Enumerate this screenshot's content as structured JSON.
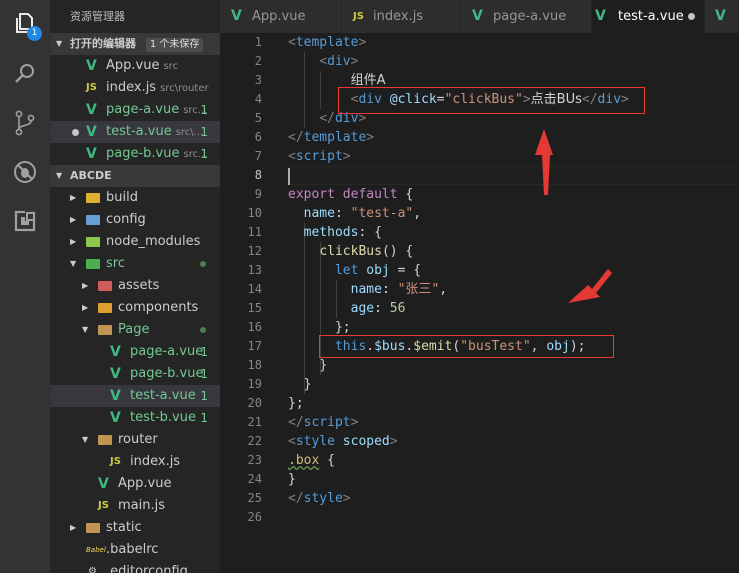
{
  "activity_bar": {
    "badge": "1",
    "icons": [
      "files-icon",
      "search-icon",
      "source-control-icon",
      "debug-icon",
      "extensions-icon"
    ]
  },
  "sidebar": {
    "title": "资源管理器",
    "open_editors": {
      "header": "打开的编辑器",
      "unsaved": "1 个未保存",
      "items": [
        {
          "name": "App.vue",
          "desc": "src",
          "type": "vue",
          "count": ""
        },
        {
          "name": "index.js",
          "desc": "src\\router",
          "type": "js",
          "count": ""
        },
        {
          "name": "page-a.vue",
          "desc": "src...",
          "type": "vue",
          "count": "1"
        },
        {
          "name": "test-a.vue",
          "desc": "src\\...",
          "type": "vue",
          "count": "1"
        },
        {
          "name": "page-b.vue",
          "desc": "src...",
          "type": "vue",
          "count": "1"
        }
      ]
    },
    "project": {
      "header": "ABCDE",
      "items": [
        {
          "name": "build",
          "count": ""
        },
        {
          "name": "config",
          "count": ""
        },
        {
          "name": "node_modules",
          "count": ""
        },
        {
          "name": "src",
          "count": ""
        },
        {
          "name": "assets",
          "count": ""
        },
        {
          "name": "components",
          "count": ""
        },
        {
          "name": "Page",
          "count": ""
        },
        {
          "name": "page-a.vue",
          "count": "1"
        },
        {
          "name": "page-b.vue",
          "count": "1"
        },
        {
          "name": "test-a.vue",
          "count": "1"
        },
        {
          "name": "test-b.vue",
          "count": "1"
        },
        {
          "name": "router",
          "count": ""
        },
        {
          "name": "index.js",
          "count": ""
        },
        {
          "name": "App.vue",
          "count": ""
        },
        {
          "name": "main.js",
          "count": ""
        },
        {
          "name": "static",
          "count": ""
        },
        {
          "name": ".babelrc",
          "count": ""
        },
        {
          "name": ".editorconfig",
          "count": ""
        }
      ]
    }
  },
  "tabs": [
    {
      "label": "App.vue",
      "type": "vue"
    },
    {
      "label": "index.js",
      "type": "js"
    },
    {
      "label": "page-a.vue",
      "type": "vue"
    },
    {
      "label": "test-a.vue",
      "type": "vue"
    }
  ],
  "editor": {
    "line_numbers": [
      "1",
      "2",
      "3",
      "4",
      "5",
      "6",
      "7",
      "8",
      "9",
      "10",
      "11",
      "12",
      "13",
      "14",
      "15",
      "16",
      "17",
      "18",
      "19",
      "20",
      "21",
      "22",
      "23",
      "24",
      "25",
      "26"
    ],
    "current_line": "8"
  },
  "colors": {
    "accent": "#1e88e5",
    "annotation": "#e53935",
    "vue_green": "#41b883",
    "modified_green": "#73c991"
  }
}
